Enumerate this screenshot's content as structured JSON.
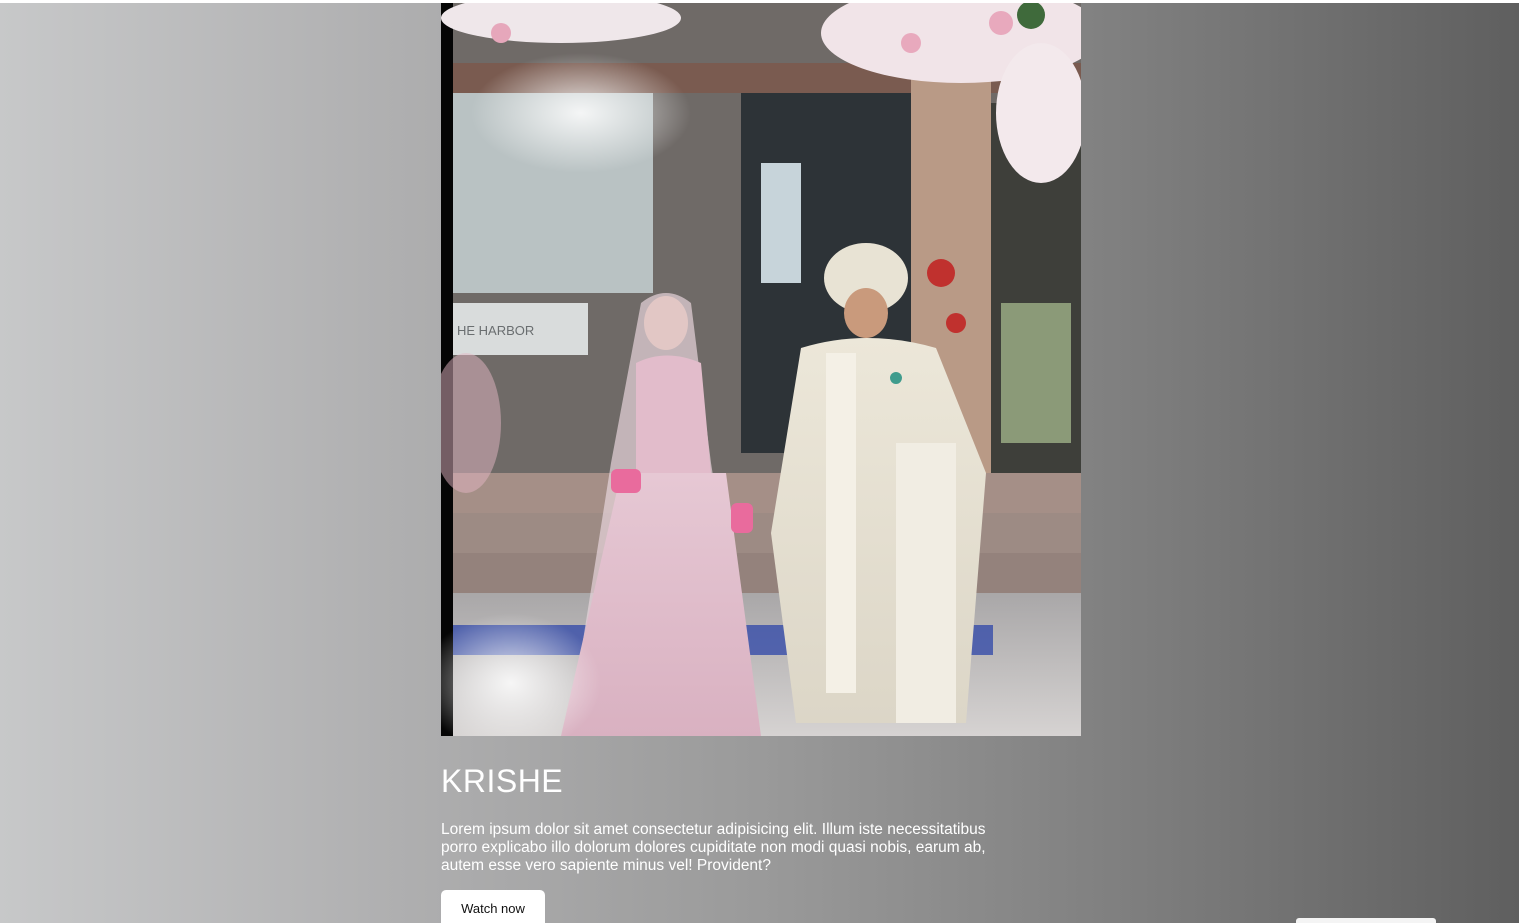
{
  "slide": {
    "title": "KRISHE",
    "description": "Lorem ipsum dolor sit amet consectetur adipisicing elit. Illum iste necessitatibus porro explicabo illo dolorum dolores cupiditate non modi quasi nobis, earum ab, autem esse vero sapiente minus vel! Provident?",
    "button_label": "Watch now",
    "sign_text": "HE HARBOR"
  },
  "colors": {
    "background_left": "#c7c8c9",
    "background_right": "#5f5f5f",
    "text": "#ffffff",
    "button_bg": "#ffffff"
  }
}
